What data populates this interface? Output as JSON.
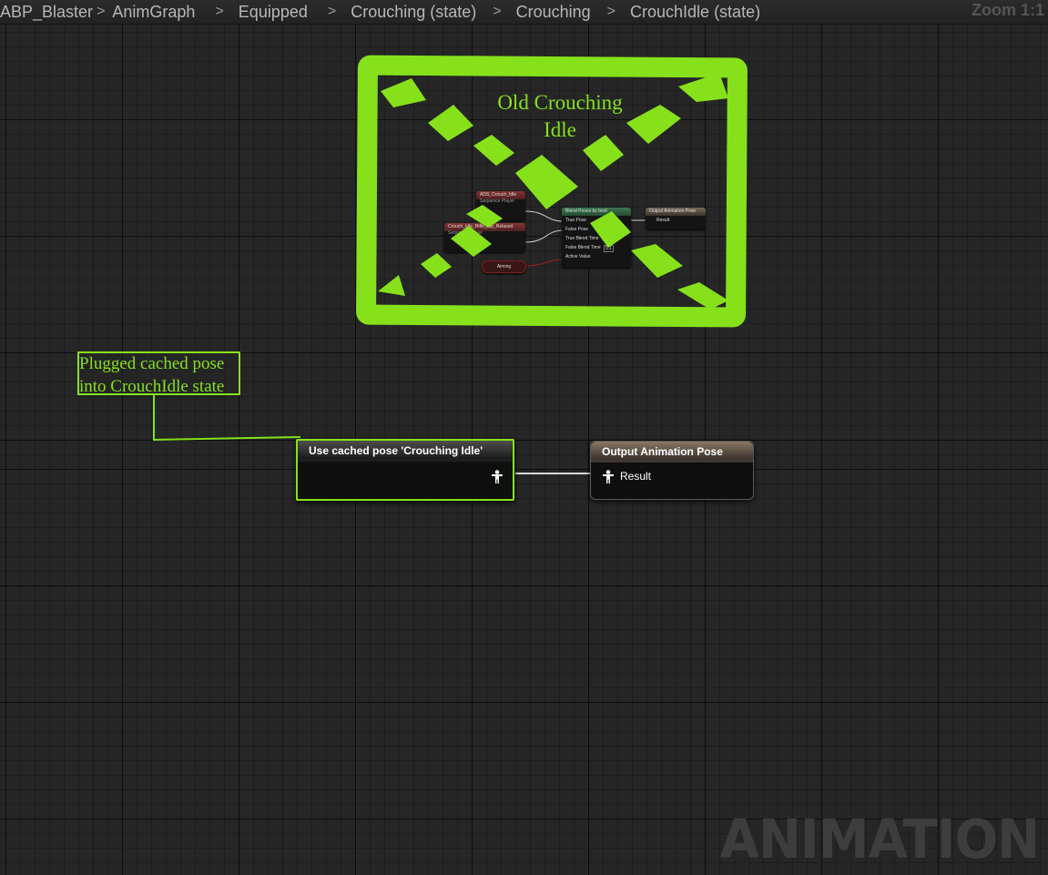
{
  "breadcrumb": {
    "items": [
      "ABP_Blaster",
      "AnimGraph",
      "Equipped",
      "Crouching (state)",
      "Crouching",
      "CrouchIdle (state)"
    ],
    "separator": ">"
  },
  "zoom_label": "Zoom 1:1",
  "comment_box": {
    "title_line1": "Old Crouching",
    "title_line2": "Idle",
    "color": "#86e11b"
  },
  "thumbnail_graph": {
    "node1_title": "ADS_Crouch_Idle",
    "node1_sub": "Sequence Player",
    "node2_title": "Crouch_Idle_Rifle_Hip_Relaxed",
    "node2_sub": "Sequence Player",
    "aiming_var": "Aiming",
    "blend_title": "Blend Poses by bool",
    "blend_pins": [
      "True Pose",
      "False Pose",
      "True Blend Time",
      "False Blend Time",
      "Active Value"
    ],
    "blend_value": "0.1",
    "output_title": "Output Animation Pose",
    "output_pin": "Result"
  },
  "note": {
    "line1": "Plugged cached pose",
    "line2": "into CrouchIdle state"
  },
  "cached_node": {
    "title": "Use cached pose 'Crouching Idle'",
    "pin_icon": "pose-pin-icon"
  },
  "output_node": {
    "title": "Output Animation Pose",
    "pin_label": "Result",
    "pin_icon": "pose-pin-icon"
  },
  "watermark": "ANIMATION"
}
